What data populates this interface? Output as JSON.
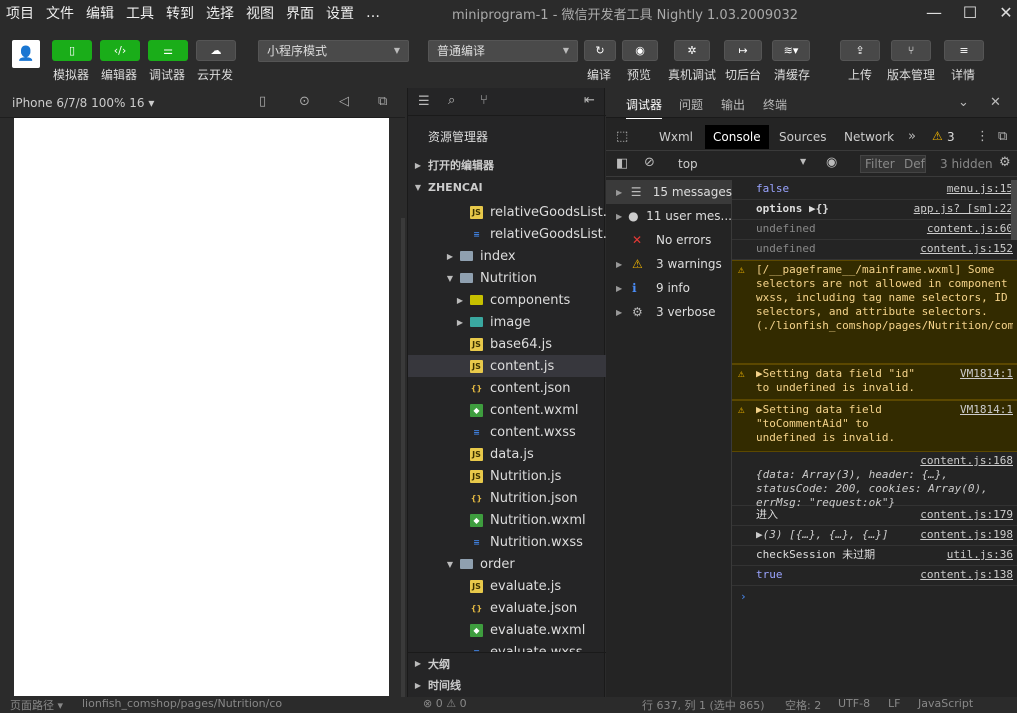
{
  "menu": [
    "项目",
    "文件",
    "编辑",
    "工具",
    "转到",
    "选择",
    "视图",
    "界面",
    "设置",
    "…"
  ],
  "window_title": "miniprogram-1 - 微信开发者工具 Nightly 1.03.2009032",
  "toolbar": {
    "left_labels": [
      "模拟器",
      "编辑器",
      "调试器",
      "云开发"
    ],
    "mode_select": "小程序模式",
    "compile_select": "普通编译",
    "right_labels": [
      "编译",
      "预览",
      "真机调试",
      "切后台",
      "清缓存",
      "上传",
      "版本管理",
      "详情"
    ]
  },
  "simulator": {
    "device": "iPhone 6/7/8 100% 16 ▾"
  },
  "editor": {
    "title": "资源管理器",
    "open_editors": "打开的编辑器",
    "project": "ZHENCAI",
    "outline": "大纲",
    "timeline": "时间线",
    "tree": [
      {
        "name": "relativeGoodsList...",
        "type": "js",
        "indent": 3
      },
      {
        "name": "relativeGoodsList...",
        "type": "wxss",
        "indent": 3
      },
      {
        "name": "index",
        "type": "folder",
        "indent": 2,
        "arrow": "▶"
      },
      {
        "name": "Nutrition",
        "type": "folder",
        "indent": 2,
        "arrow": "▼"
      },
      {
        "name": "components",
        "type": "folder-comp",
        "indent": 3,
        "arrow": "▶"
      },
      {
        "name": "image",
        "type": "folder-img",
        "indent": 3,
        "arrow": "▶"
      },
      {
        "name": "base64.js",
        "type": "js",
        "indent": 3
      },
      {
        "name": "content.js",
        "type": "js",
        "indent": 3,
        "selected": true
      },
      {
        "name": "content.json",
        "type": "json",
        "indent": 3
      },
      {
        "name": "content.wxml",
        "type": "wxml",
        "indent": 3
      },
      {
        "name": "content.wxss",
        "type": "wxss",
        "indent": 3
      },
      {
        "name": "data.js",
        "type": "js",
        "indent": 3
      },
      {
        "name": "Nutrition.js",
        "type": "js",
        "indent": 3
      },
      {
        "name": "Nutrition.json",
        "type": "json",
        "indent": 3
      },
      {
        "name": "Nutrition.wxml",
        "type": "wxml",
        "indent": 3
      },
      {
        "name": "Nutrition.wxss",
        "type": "wxss",
        "indent": 3
      },
      {
        "name": "order",
        "type": "folder",
        "indent": 2,
        "arrow": "▼"
      },
      {
        "name": "evaluate.js",
        "type": "js",
        "indent": 3
      },
      {
        "name": "evaluate.json",
        "type": "json",
        "indent": 3
      },
      {
        "name": "evaluate.wxml",
        "type": "wxml",
        "indent": 3
      },
      {
        "name": "evaluate.wxss",
        "type": "wxss",
        "indent": 3
      }
    ]
  },
  "devtools": {
    "tabs": [
      "调试器",
      "问题",
      "输出",
      "终端"
    ],
    "panel_tabs": [
      "Wxml",
      "Console",
      "Sources",
      "Network"
    ],
    "warning_count": "3",
    "context": "top",
    "filter_placeholder": "Filter",
    "level": "Def",
    "hidden": "3 hidden",
    "sidebar": [
      {
        "label": "15 messages",
        "icon": "list"
      },
      {
        "label": "11 user mes...",
        "icon": "user"
      },
      {
        "label": "No errors",
        "icon": "error"
      },
      {
        "label": "3 warnings",
        "icon": "warning"
      },
      {
        "label": "9 info",
        "icon": "info"
      },
      {
        "label": "3 verbose",
        "icon": "verbose"
      }
    ],
    "logs": [
      {
        "text": "false",
        "src": "menu.js:15"
      },
      {
        "text": "options ▶{}",
        "src": "app.js? [sm]:22"
      },
      {
        "text": "undefined",
        "src": "content.js:60"
      },
      {
        "text": "undefined",
        "src": "content.js:152"
      },
      {
        "text": "[/__pageframe__/mainframe.wxml] Some selectors are not allowed in component wxss, including tag name selectors, ID selectors, and attribute selectors.(./lionfish_comshop/pages/Nutrition/components/menu/menu.wxss:31:12)",
        "src": ""
      },
      {
        "text": "▶Setting data field \"id\" to undefined is invalid.",
        "src": "VM1814:1"
      },
      {
        "text": "▶Setting data field \"toCommentAid\" to undefined is invalid.",
        "src": "VM1814:1"
      },
      {
        "text": "{data: Array(3), header: {…}, statusCode: 200, cookies: Array(0), errMsg: \"request:ok\"}",
        "src": "content.js:168"
      },
      {
        "text": "进入",
        "src": "content.js:179"
      },
      {
        "text": "▶(3) [{…}, {…}, {…}]",
        "src": "content.js:198"
      },
      {
        "text": "checkSession 未过期",
        "src": "util.js:36"
      },
      {
        "text": "true",
        "src": "content.js:138"
      }
    ]
  },
  "status": {
    "path_label": "页面路径 ▾",
    "path": "lionfish_comshop/pages/Nutrition/co",
    "errors": "⊗ 0 ⚠ 0",
    "cursor": "行 637, 列 1 (选中 865)",
    "spaces": "空格: 2",
    "encoding": "UTF-8",
    "eol": "LF",
    "language": "JavaScript"
  },
  "colors": {
    "green": "#1aad19",
    "js": "#e8c94a",
    "wxss": "#3f7fdc",
    "wxml": "#4caf50",
    "json": "#e0b640"
  }
}
